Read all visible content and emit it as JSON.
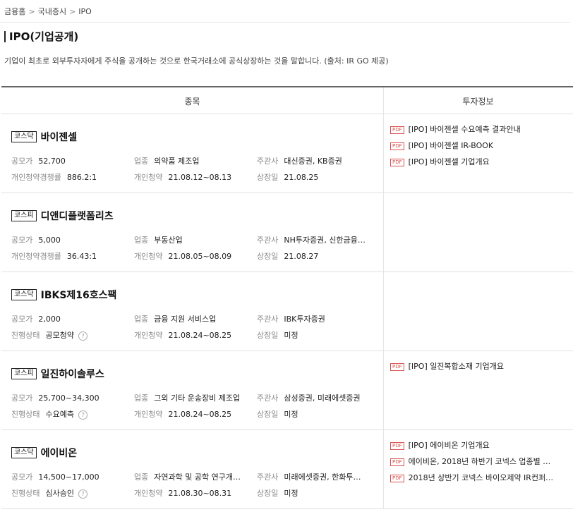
{
  "breadcrumb": [
    "금융홈",
    "국내증시",
    "IPO"
  ],
  "title": "IPO(기업공개)",
  "description": "기업이 최초로 외부투자자에게 주식을 공개하는 것으로 한국거래소에 공식상장하는 것을 말합니다. (출처: IR GO 제공)",
  "headers": {
    "stock": "종목",
    "info": "투자정보"
  },
  "labels": {
    "offer_price": "공모가",
    "industry": "업종",
    "underwriter": "주관사",
    "competition": "개인청약경쟁률",
    "status": "진행상태",
    "subscription": "개인청약",
    "listing": "상장일"
  },
  "rows": [
    {
      "market": "코스닥",
      "name": "바이젠셀",
      "offer_price": "52,700",
      "industry": "의약품 제조업",
      "underwriter": "대신증권, KB증권",
      "sub_label": "개인청약경쟁률",
      "sub_value": "886.2:1",
      "subscription": "21.08.12~08.13",
      "listing": "21.08.25",
      "docs": [
        "[IPO] 바이젠셀 수요예측 결과안내",
        "[IPO] 바이젠셀 IR-BOOK",
        "[IPO] 바이젠셀 기업개요"
      ]
    },
    {
      "market": "코스피",
      "name": "디앤디플랫폼리츠",
      "offer_price": "5,000",
      "industry": "부동산업",
      "underwriter": "NH투자증권, 신한금융…",
      "sub_label": "개인청약경쟁률",
      "sub_value": "36.43:1",
      "subscription": "21.08.05~08.09",
      "listing": "21.08.27",
      "docs": []
    },
    {
      "market": "코스닥",
      "name": "IBKS제16호스팩",
      "offer_price": "2,000",
      "industry": "금융 지원 서비스업",
      "underwriter": "IBK투자증권",
      "sub_label": "진행상태",
      "sub_value": "공모청약",
      "subscription": "21.08.24~08.25",
      "listing": "미정",
      "docs": []
    },
    {
      "market": "코스피",
      "name": "일진하이솔루스",
      "offer_price": "25,700~34,300",
      "industry": "그외 기타 운송장비 제조업",
      "underwriter": "삼성증권, 미래에셋증권",
      "sub_label": "진행상태",
      "sub_value": "수요예측",
      "subscription": "21.08.24~08.25",
      "listing": "미정",
      "docs": [
        "[IPO] 일진복합소재 기업개요"
      ]
    },
    {
      "market": "코스닥",
      "name": "에이비온",
      "offer_price": "14,500~17,000",
      "industry": "자연과학 및 공학 연구개…",
      "underwriter": "미래에셋증권, 한화투…",
      "sub_label": "진행상태",
      "sub_value": "심사승인",
      "subscription": "21.08.30~08.31",
      "listing": "미정",
      "docs": [
        "[IPO] 에이비온 기업개요",
        "에이비온, 2018년 하반기 코넥스 업종별 …",
        "2018년 상반기 코넥스 바이오제약 IR컨퍼…"
      ]
    }
  ],
  "help_mark": "?",
  "pdf_mark": "PDF",
  "separator": ">"
}
